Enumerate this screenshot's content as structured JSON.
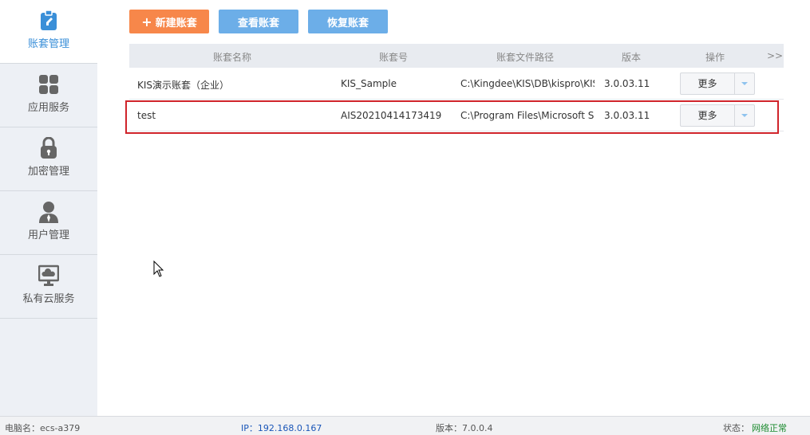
{
  "sidebar": {
    "items": [
      {
        "label": "账套管理",
        "icon": "ledger-icon",
        "active": true
      },
      {
        "label": "应用服务",
        "icon": "grid-icon"
      },
      {
        "label": "加密管理",
        "icon": "lock-icon"
      },
      {
        "label": "用户管理",
        "icon": "user-icon"
      },
      {
        "label": "私有云服务",
        "icon": "cloud-monitor-icon"
      }
    ]
  },
  "toolbar": {
    "new_label": "新建账套",
    "view_label": "查看账套",
    "restore_label": "恢复账套"
  },
  "table": {
    "headers": [
      "账套名称",
      "账套号",
      "账套文件路径",
      "版本",
      "操作",
      ">>"
    ],
    "rows": [
      {
        "name": "KIS演示账套（企业）",
        "id": "KIS_Sample",
        "path": "C:\\Kingdee\\KIS\\DB\\kispro\\KIS",
        "version": "3.0.03.11",
        "action": "更多"
      },
      {
        "name": "test",
        "id": "AIS20210414173419",
        "path": "C:\\Program Files\\Microsoft SC",
        "version": "3.0.03.11",
        "action": "更多"
      }
    ]
  },
  "status": {
    "computer": "电脑名：ecs-a379",
    "ip": "IP：192.168.0.167",
    "version": "版本：7.0.0.4",
    "state_label": "状态：",
    "state_value": "网络正常"
  },
  "colors": {
    "accent_orange": "#f7874a",
    "accent_blue": "#6caee8",
    "highlight_red": "#d0242b"
  }
}
